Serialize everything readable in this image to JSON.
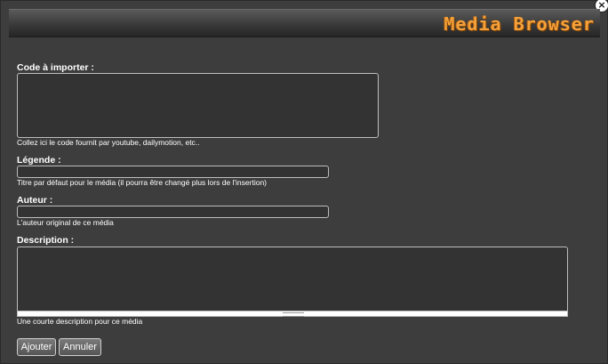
{
  "window": {
    "title": "Media Browser",
    "close_glyph": "×",
    "close_icon": "close-icon"
  },
  "form": {
    "code": {
      "label": "Code à importer :",
      "value": "",
      "hint": "Collez ici le code fournit par youtube, dailymotion, etc.."
    },
    "legende": {
      "label": "Légende :",
      "value": "",
      "hint": "Titre par défaut pour le média (il pourra être changé plus lors de l'insertion)"
    },
    "auteur": {
      "label": "Auteur :",
      "value": "",
      "hint": "L'auteur original de ce média"
    },
    "description": {
      "label": "Description :",
      "value": "",
      "hint": "Une courte description pour ce média"
    }
  },
  "buttons": {
    "add_label": "Ajouter",
    "cancel_label": "Annuler"
  },
  "colors": {
    "background": "#3d3d3d",
    "title_accent": "#f3a13b",
    "field_border": "#bdbdbd"
  }
}
